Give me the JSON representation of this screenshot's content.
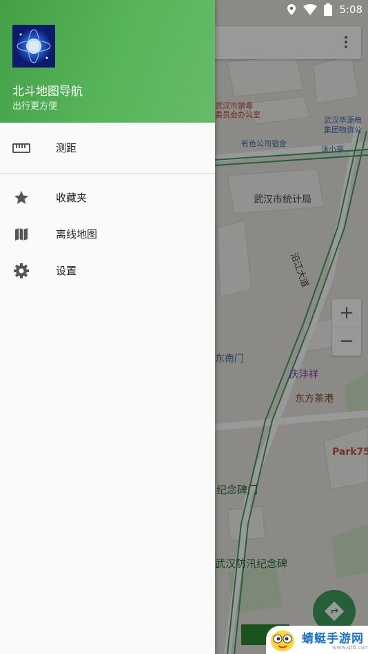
{
  "status_bar": {
    "time": "5:08"
  },
  "drawer": {
    "app_title": "北斗地图导航",
    "app_subtitle": "出行更方便",
    "primary_items": [
      {
        "label": "测距",
        "icon": "ruler-icon"
      }
    ],
    "secondary_items": [
      {
        "label": "收藏夹",
        "icon": "star-icon"
      },
      {
        "label": "离线地图",
        "icon": "map-icon"
      },
      {
        "label": "设置",
        "icon": "gear-icon"
      }
    ]
  },
  "map": {
    "labels": {
      "poi_1_line1": "武汉市禁毒",
      "poi_1_line2": "委员会办公室",
      "poi_2_line1": "武汉华源电",
      "poi_2_line2": "集团物资公",
      "poi_3": "有色公司宿舍",
      "poi_4": "沫小亭",
      "poi_5": "武汉市统计局",
      "road_1": "沿江大道",
      "poi_6": "东南门",
      "poi_7": "庆沣祥",
      "poi_8": "东方茶港",
      "poi_9": "Park75",
      "poi_10": "纪念碑门",
      "poi_11": "武汉防汛纪念碑"
    },
    "zoom_in": "+",
    "zoom_out": "−"
  },
  "watermark": {
    "text": "蜻蜓手游网",
    "url": "www.qt6.com"
  },
  "colors": {
    "drawer_header": "#4caf50",
    "accent_green": "#3f9d5e"
  }
}
